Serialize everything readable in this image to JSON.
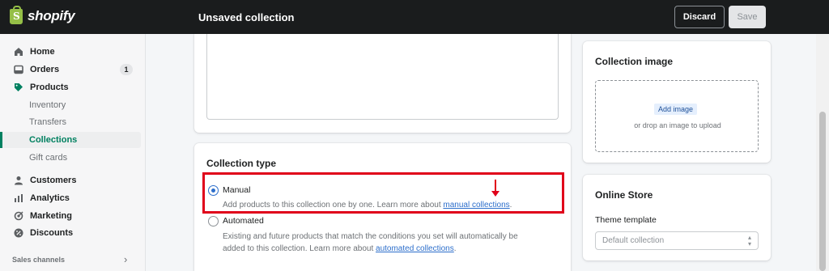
{
  "topbar": {
    "logo_text": "shopify",
    "page_title": "Unsaved collection",
    "discard_label": "Discard",
    "save_label": "Save"
  },
  "sidebar": {
    "items": [
      {
        "label": "Home",
        "icon": "home-icon"
      },
      {
        "label": "Orders",
        "icon": "orders-icon",
        "badge": "1"
      },
      {
        "label": "Products",
        "icon": "tag-icon"
      },
      {
        "label": "Inventory"
      },
      {
        "label": "Transfers"
      },
      {
        "label": "Collections",
        "active": true
      },
      {
        "label": "Gift cards"
      },
      {
        "label": "Customers",
        "icon": "person-icon"
      },
      {
        "label": "Analytics",
        "icon": "bar-chart-icon"
      },
      {
        "label": "Marketing",
        "icon": "target-icon"
      },
      {
        "label": "Discounts",
        "icon": "discount-icon"
      }
    ],
    "sales_channels": "Sales channels"
  },
  "collection_type": {
    "title": "Collection type",
    "manual": {
      "label": "Manual",
      "help": "Add products to this collection one by one. Learn more about ",
      "link": "manual collections",
      "selected": true
    },
    "automated": {
      "label": "Automated",
      "help_line1": "Existing and future products that match the conditions you set will automatically be",
      "help_line2": "added to this collection. Learn more about ",
      "link": "automated collections",
      "selected": false
    }
  },
  "collection_image": {
    "title": "Collection image",
    "add_image": "Add image",
    "drop_hint": "or drop an image to upload"
  },
  "online_store": {
    "title": "Online Store",
    "theme_label": "Theme template",
    "theme_value": "Default collection"
  },
  "colors": {
    "accent": "#008060",
    "link": "#2c6ecb",
    "highlight": "#e0001a",
    "topbar": "#1a1c1d"
  }
}
